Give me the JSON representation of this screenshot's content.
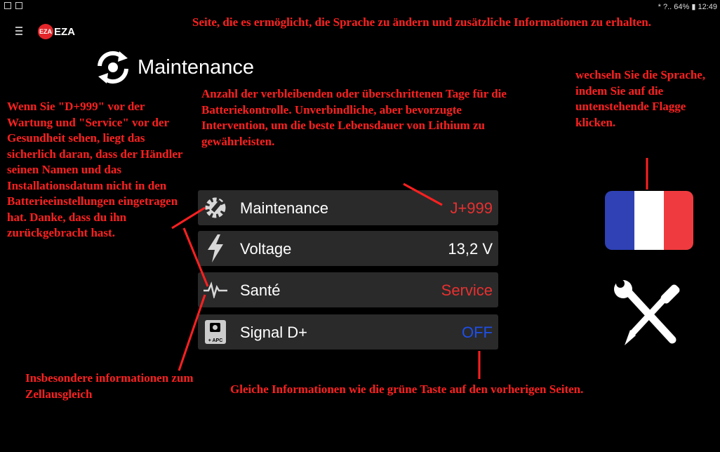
{
  "status_bar": {
    "right_text": "* ?.. 64% ▮ 12:49"
  },
  "app": {
    "logo_badge": "EZA",
    "logo_text": "EZA",
    "accent": "#e3262a"
  },
  "page": {
    "title": "Maintenance",
    "title_icon": "sync-arrows-icon"
  },
  "rows": [
    {
      "label": "Maintenance",
      "value": "J+999",
      "value_color": "#e83030",
      "icon": "gear-wrench-icon"
    },
    {
      "label": "Voltage",
      "value": "13,2 V",
      "value_color": "#ffffff",
      "icon": "lightning-icon"
    },
    {
      "label": "Santé",
      "value": "Service",
      "value_color": "#e83030",
      "icon": "pulse-icon"
    },
    {
      "label": "Signal D+",
      "value": "OFF",
      "value_color": "#1e4fe8",
      "icon": "apc-plug-icon",
      "icon_text": "+ APC"
    }
  ],
  "language_flag": {
    "icon": "france-flag-icon",
    "colors": [
      "#2f41b4",
      "#ffffff",
      "#ef3b3f"
    ]
  },
  "settings_icon": "tools-icon",
  "annotations": {
    "top": "Seite, die es ermöglicht, die Sprache zu ändern und zusätzliche Informationen zu erhalten.",
    "middle": "Anzahl der verbleibenden oder überschrittenen Tage für die Batteriekontrolle. Unverbindliche, aber bevorzugte Intervention, um die beste Lebensdauer von Lithium zu gewährleisten.",
    "left": "Wenn Sie \"D+999\" vor der Wartung und \"Service\" vor der Gesundheit sehen, liegt das sicherlich daran, dass der Händler seinen Namen und das Installationsdatum nicht in den Batterieeinstellungen eingetragen hat. Danke, dass du ihn zurückgebracht hast.",
    "right": "wechseln Sie die Sprache, indem Sie auf die untenstehende Flagge klicken.",
    "bottom_left": "Insbesondere informationen zum Zellausgleich",
    "bottom": "Gleiche Informationen wie die grüne Taste auf den vorherigen Seiten."
  }
}
